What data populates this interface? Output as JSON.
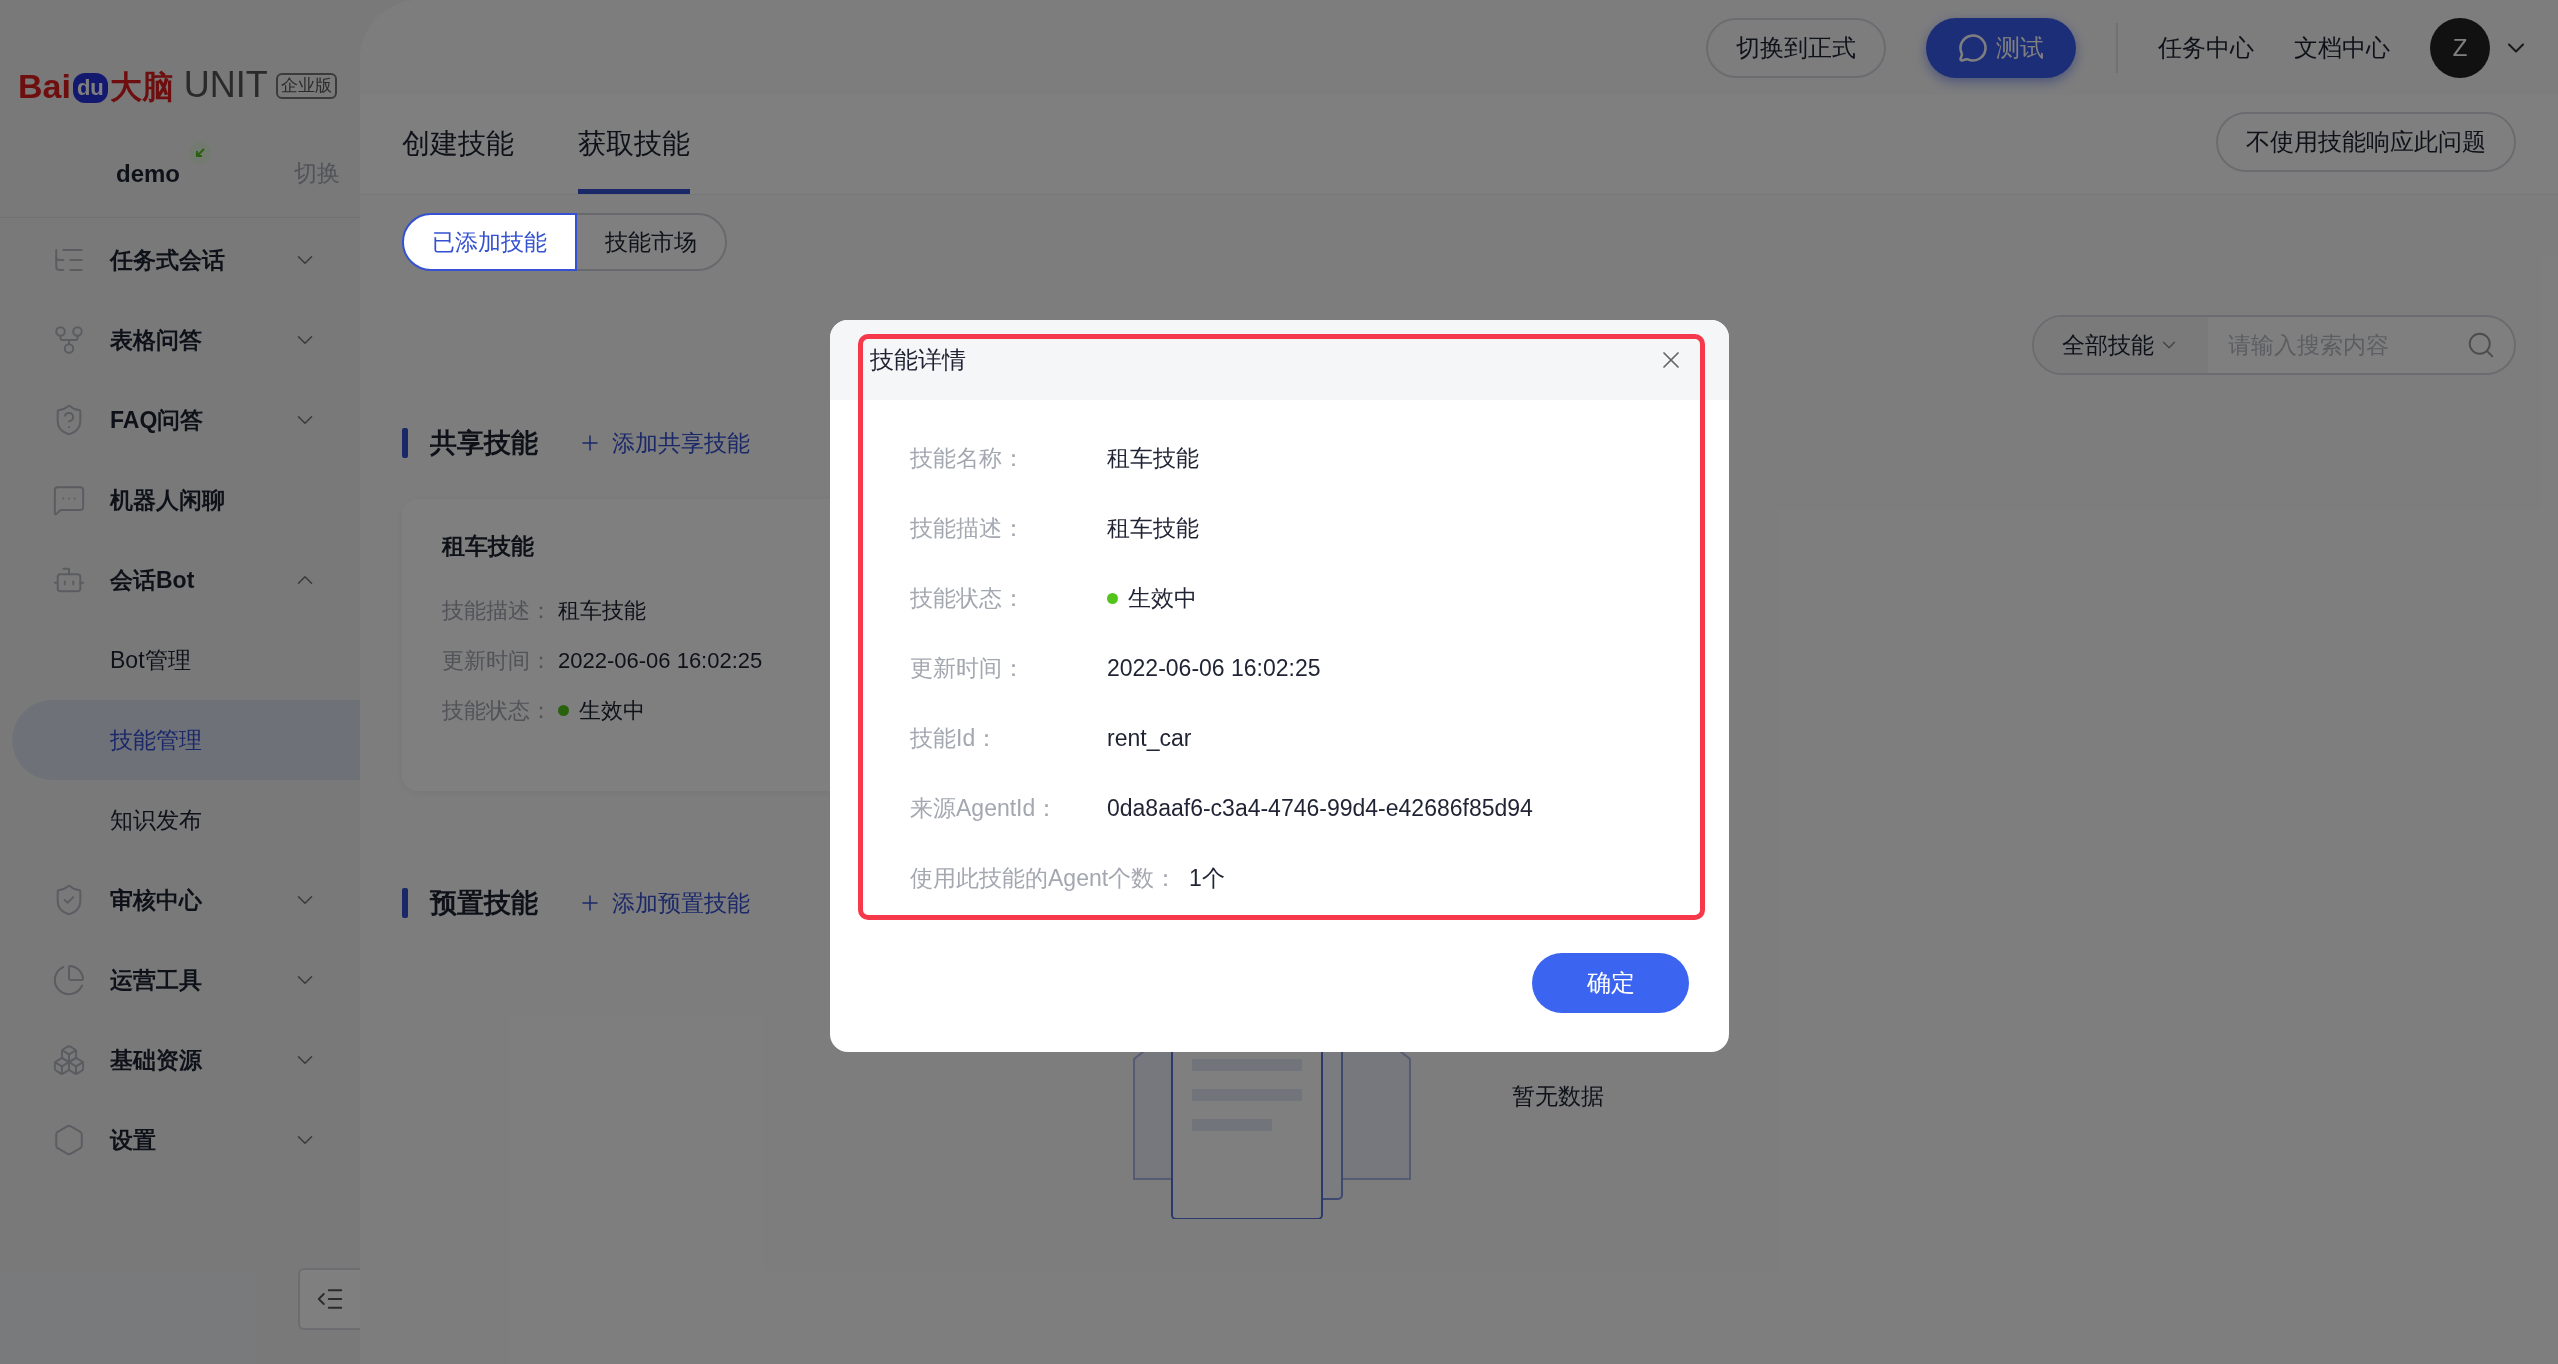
{
  "logo": {
    "prefix": "Bai",
    "paw": "du",
    "name_cn": "大脑",
    "product": "UNIT",
    "edition": "企业版"
  },
  "sidebar": {
    "bot_name": "demo",
    "switch": "切换",
    "items": [
      {
        "label": "任务式会话",
        "expanded": false
      },
      {
        "label": "表格问答",
        "expanded": false
      },
      {
        "label": "FAQ问答",
        "expanded": false
      },
      {
        "label": "机器人闲聊"
      },
      {
        "label": "会话Bot",
        "expanded": true,
        "children": [
          {
            "label": "Bot管理",
            "selected": false
          },
          {
            "label": "技能管理",
            "selected": true
          },
          {
            "label": "知识发布",
            "selected": false
          }
        ]
      },
      {
        "label": "审核中心",
        "expanded": false
      },
      {
        "label": "运营工具",
        "expanded": false
      },
      {
        "label": "基础资源",
        "expanded": false
      },
      {
        "label": "设置",
        "expanded": false
      }
    ]
  },
  "header": {
    "switch_button": "切换到正式",
    "test_button": "测试",
    "links": [
      "任务中心",
      "文档中心"
    ],
    "avatar": "Z"
  },
  "tabs": [
    {
      "label": "创建技能",
      "selected": false
    },
    {
      "label": "获取技能",
      "selected": true
    }
  ],
  "no_skill_button": "不使用技能响应此问题",
  "segments": [
    {
      "label": "已添加技能",
      "selected": true
    },
    {
      "label": "技能市场",
      "selected": false
    }
  ],
  "filter": {
    "category": "全部技能",
    "placeholder": "请输入搜索内容"
  },
  "sections": [
    {
      "title": "共享技能",
      "add": "添加共享技能",
      "cards": [
        {
          "title": "租车技能",
          "fields": [
            {
              "label": "技能描述：",
              "value": "租车技能",
              "kind": "text"
            },
            {
              "label": "更新时间：",
              "value": "2022-06-06 16:02:25",
              "kind": "text"
            },
            {
              "label": "技能状态：",
              "value": "生效中",
              "kind": "status"
            }
          ]
        }
      ]
    },
    {
      "title": "预置技能",
      "add": "添加预置技能",
      "empty": "暂无数据"
    }
  ],
  "dialog": {
    "title": "技能详情",
    "fields": [
      {
        "label": "技能名称：",
        "value": "租车技能",
        "kind": "text"
      },
      {
        "label": "技能描述：",
        "value": "租车技能",
        "kind": "text"
      },
      {
        "label": "技能状态：",
        "value": "生效中",
        "kind": "status",
        "color": "#52c41a"
      },
      {
        "label": "更新时间：",
        "value": "2022-06-06 16:02:25",
        "kind": "text"
      },
      {
        "label": "技能Id：",
        "value": "rent_car",
        "kind": "text"
      },
      {
        "label": "来源AgentId：",
        "value": "0da8aaf6-c3a4-4746-99d4-e42686f85d94",
        "kind": "text"
      },
      {
        "label": "使用此技能的Agent个数：",
        "value": "1个",
        "kind": "text"
      }
    ],
    "ok": "确定"
  }
}
